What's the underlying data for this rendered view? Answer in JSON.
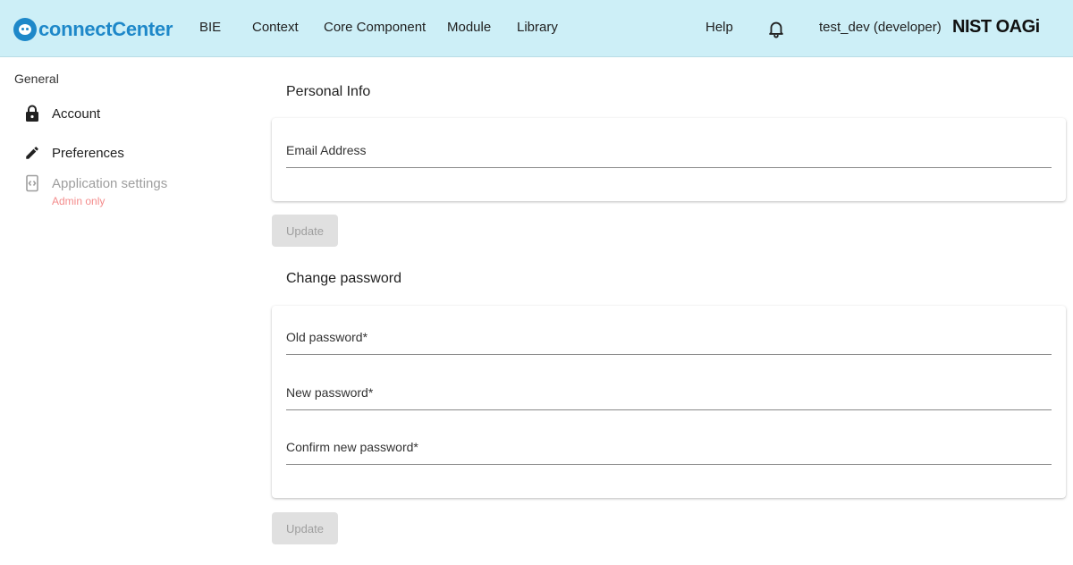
{
  "app": {
    "logo_text": "connectCenter",
    "brand": "NIST OAGi"
  },
  "nav": {
    "items": [
      "BIE",
      "Context",
      "Core Component",
      "Module",
      "Library"
    ],
    "help": "Help",
    "user": "test_dev (developer)"
  },
  "sidebar": {
    "title": "General",
    "items": [
      {
        "label": "Account",
        "icon": "lock-icon"
      },
      {
        "label": "Preferences",
        "icon": "pencil-icon"
      },
      {
        "label": "Application settings",
        "icon": "settings-app-icon",
        "note": "Admin only"
      }
    ]
  },
  "personal_info": {
    "title": "Personal Info",
    "email_label": "Email Address",
    "update_label": "Update"
  },
  "change_password": {
    "title": "Change password",
    "old_label": "Old password*",
    "new_label": "New password*",
    "confirm_label": "Confirm new password*",
    "update_label": "Update"
  },
  "colors": {
    "topbar": "#cdeff7",
    "accent": "#1e88c9",
    "admin_note": "#f48c8c"
  }
}
